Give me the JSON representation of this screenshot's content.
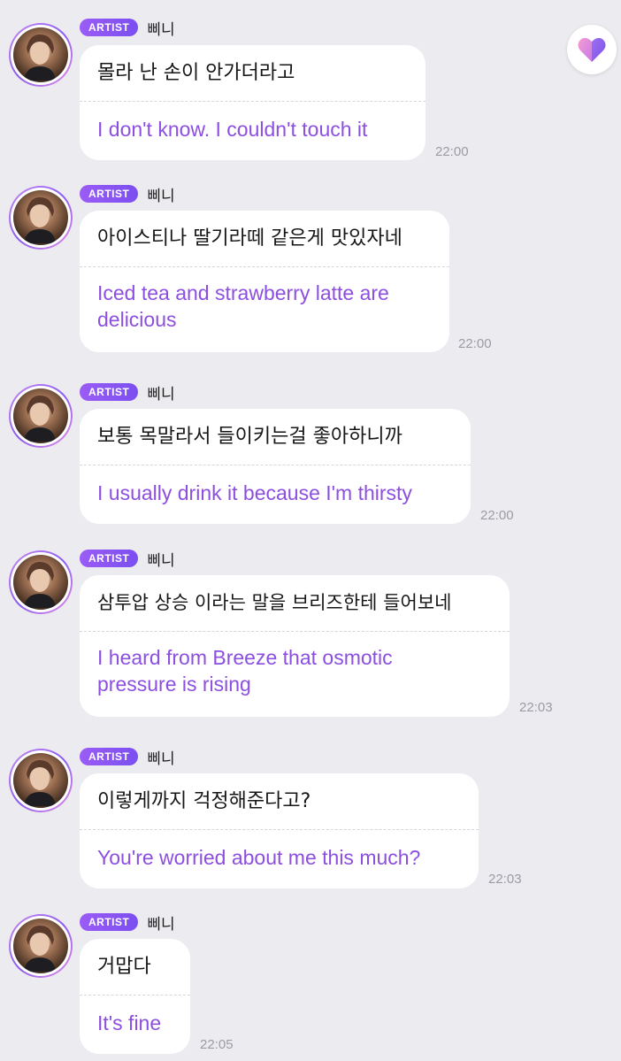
{
  "badge_label": "ARTIST",
  "sender_name": "삐니",
  "messages": [
    {
      "original": "몰라 난 손이 안가더라고",
      "translation": "I don't know. I couldn't touch it",
      "time": "22:00"
    },
    {
      "original": "아이스티나 딸기라떼 같은게 맛있자네",
      "translation": "Iced tea and strawberry latte are delicious",
      "time": "22:00"
    },
    {
      "original": "보통 목말라서 들이키는걸 좋아하니까",
      "translation": "I usually drink it because I'm thirsty",
      "time": "22:00"
    },
    {
      "original": "삼투압 상승 이라는 말을 브리즈한테 들어보네",
      "translation": "I heard from Breeze that osmotic pressure is rising",
      "time": "22:03"
    },
    {
      "original": "이렇게까지 걱정해준다고?",
      "translation": "You're worried about me this much?",
      "time": "22:03"
    },
    {
      "original": "거맙다",
      "translation": "It's fine",
      "time": "22:05"
    }
  ],
  "colors": {
    "background": "#ececf0",
    "bubble": "#ffffff",
    "translation_text": "#8c4fe0",
    "badge": "#9b5cf6",
    "timestamp": "#9b9ba3"
  },
  "icons": {
    "reaction_button": "heart-icon"
  }
}
